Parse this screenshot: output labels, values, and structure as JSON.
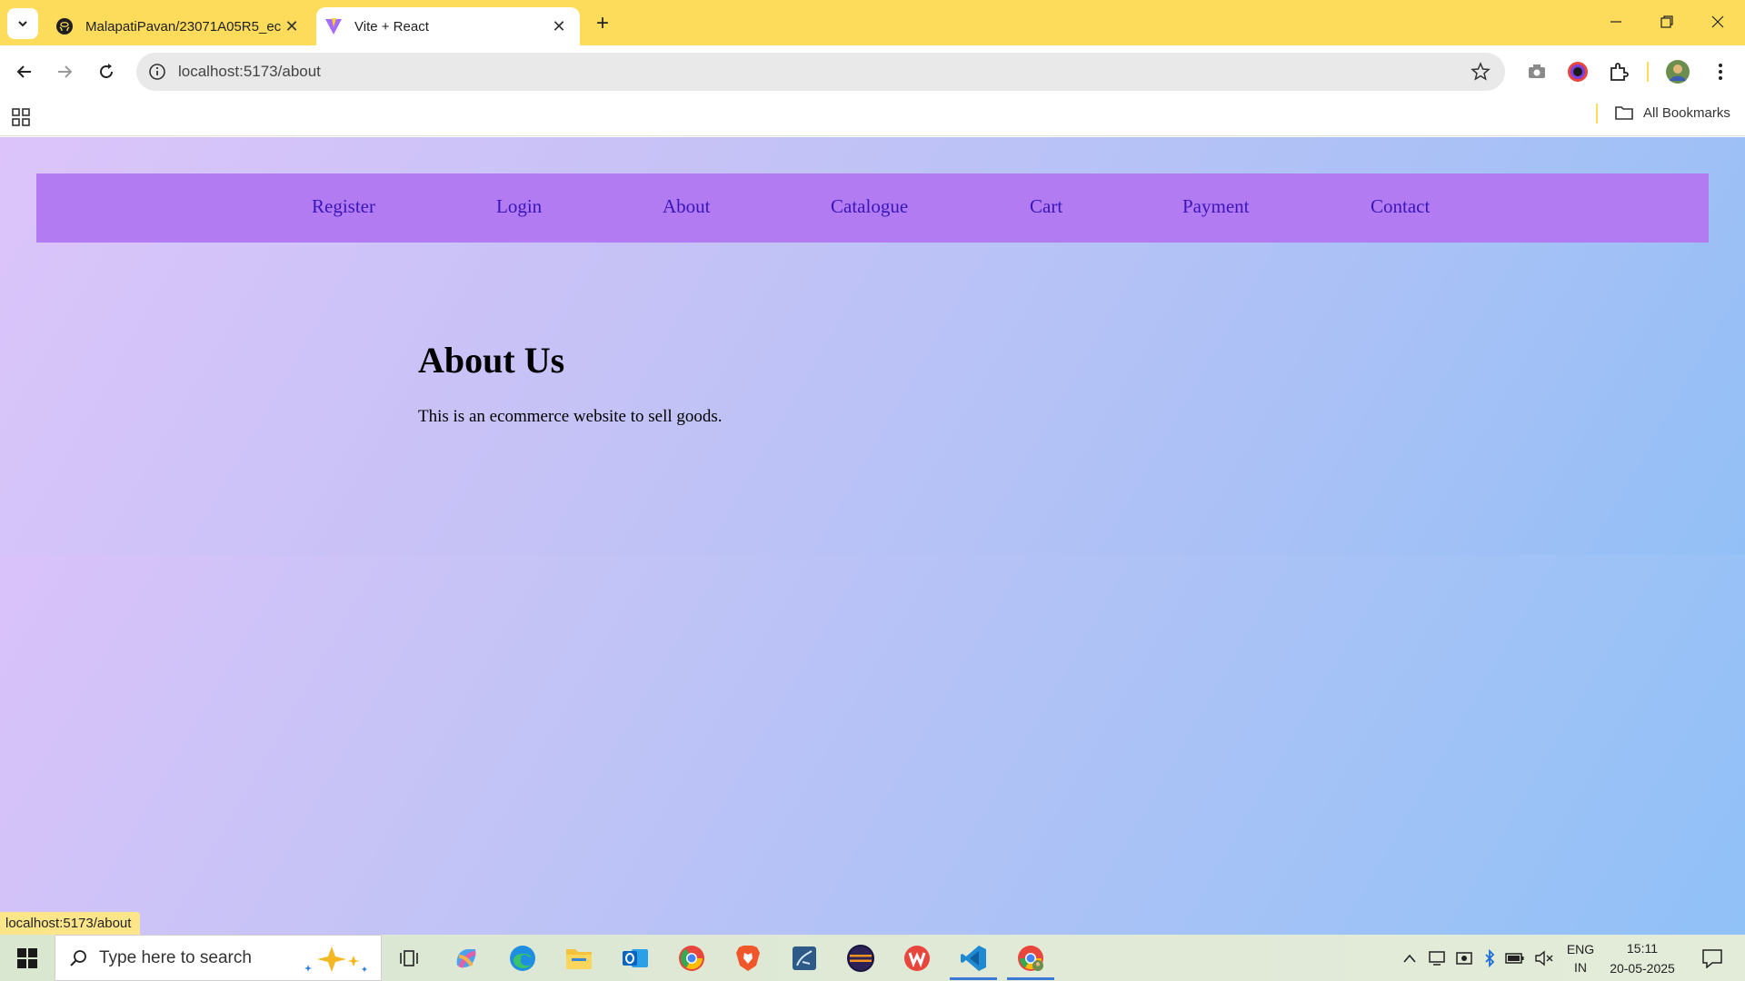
{
  "browser": {
    "tabs": [
      {
        "title": "MalapatiPavan/23071A05R5_ec",
        "active": false
      },
      {
        "title": "Vite + React",
        "active": true
      }
    ],
    "url": "localhost:5173/about",
    "bookmarks_label": "All Bookmarks",
    "status_url": "localhost:5173/about"
  },
  "nav": {
    "links": [
      "Register",
      "Login",
      "About",
      "Catalogue",
      "Cart",
      "Payment",
      "Contact"
    ]
  },
  "about": {
    "title": "About Us",
    "text": "This is an ecommerce website to sell goods."
  },
  "taskbar": {
    "search_placeholder": "Type here to search",
    "lang_top": "ENG",
    "lang_bottom": "IN",
    "time": "15:11",
    "date": "20-05-2025"
  },
  "colors": {
    "tabstrip": "#fddc5c",
    "navbar": "#b37bf2",
    "nav_link": "#3a16b8"
  }
}
